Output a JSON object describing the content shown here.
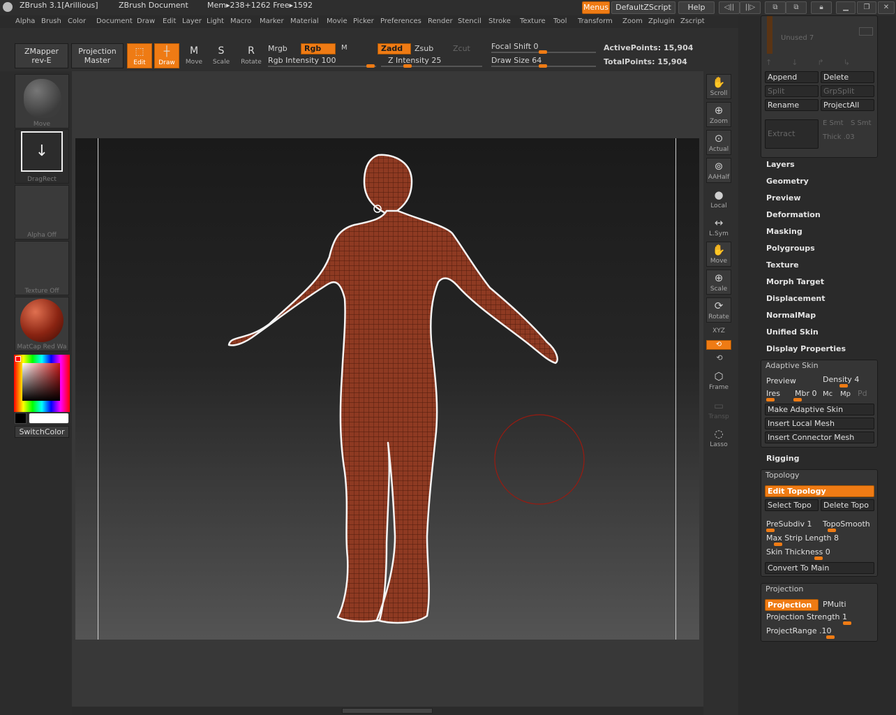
{
  "titlebar": {
    "app": "ZBrush  3.1[Arillious]",
    "document": "ZBrush Document",
    "mem": "Mem▸238+1262  Free▸1592",
    "menus_btn": "Menus",
    "zscript_btn": "DefaultZScript",
    "help_btn": "Help"
  },
  "menubar": [
    "Alpha",
    "Brush",
    "Color",
    "Document",
    "Draw",
    "Edit",
    "Layer",
    "Light",
    "Macro",
    "Marker",
    "Material",
    "Movie",
    "Picker",
    "Preferences",
    "Render",
    "Stencil",
    "Stroke",
    "Texture",
    "Tool",
    "Transform",
    "Zoom",
    "Zplugin",
    "Zscript"
  ],
  "shelf": {
    "zmapper_line1": "ZMapper",
    "zmapper_line2": "rev-E",
    "projection_line1": "Projection",
    "projection_line2": "Master",
    "edit": "Edit",
    "draw": "Draw",
    "move": "Move",
    "scale": "Scale",
    "rotate": "Rotate",
    "mrgb": "Mrgb",
    "rgb": "Rgb",
    "m": "M",
    "rgb_intensity": "Rgb  Intensity 100",
    "zadd": "Zadd",
    "zsub": "Zsub",
    "zcut": "Zcut",
    "z_intensity": "Z  Intensity 25",
    "focal_shift": "Focal  Shift 0",
    "draw_size": "Draw  Size 64",
    "active_points": "ActivePoints: 15,904",
    "total_points": "TotalPoints: 15,904"
  },
  "leftshelf": {
    "brush_label": "Move",
    "stroke_label": "DragRect",
    "alpha_label": "Alpha  Off",
    "texture_label": "Texture  Off",
    "material_label": "MatCap  Red  Wa",
    "switch_color": "SwitchColor"
  },
  "rightbar": {
    "scroll": "Scroll",
    "zoom": "Zoom",
    "actual": "Actual",
    "aahalf": "AAHalf",
    "local": "Local",
    "lsym": "L.Sym",
    "move": "Move",
    "scale": "Scale",
    "rotate": "Rotate",
    "xyz": "XYZ",
    "frame": "Frame",
    "transp": "Transp",
    "lasso": "Lasso"
  },
  "tray": {
    "unused": "Unused  7",
    "append": "Append",
    "delete": "Delete",
    "split": "Split",
    "grpsplit": "GrpSplit",
    "rename": "Rename",
    "projectall": "ProjectAll",
    "extract": "Extract",
    "e_smt": "E Smt",
    "s_smt": "S Smt",
    "thick": "Thick .03",
    "sections": [
      "Layers",
      "Geometry",
      "Preview",
      "Deformation",
      "Masking",
      "Polygroups",
      "Texture",
      "Morph Target",
      "Displacement",
      "NormalMap",
      "Unified Skin",
      "Display Properties"
    ],
    "adaptive": {
      "title": "Adaptive Skin",
      "preview": "Preview",
      "density": "Density 4",
      "ires": "Ires",
      "mbr": "Mbr 0",
      "mc": "Mc",
      "mp": "Mp",
      "pd": "Pd",
      "make": "Make Adaptive Skin",
      "insert_local": "Insert Local Mesh",
      "insert_connector": "Insert Connector Mesh"
    },
    "rigging": "Rigging",
    "topology": {
      "title": "Topology",
      "edit": "Edit Topology",
      "select": "Select Topo",
      "delete": "Delete Topo",
      "presubdiv": "PreSubdiv 1",
      "toposmooth": "TopoSmooth",
      "max_strip": "Max  Strip  Length 8",
      "skin_thickness": "Skin  Thickness 0",
      "convert": "Convert To Main"
    },
    "projection": {
      "title": "Projection",
      "projection": "Projection",
      "pmulti": "PMulti",
      "strength": "Projection  Strength 1",
      "range": "ProjectRange .10"
    }
  },
  "colors": {
    "accent": "#ef7b14",
    "skin": "#8e3a22"
  }
}
